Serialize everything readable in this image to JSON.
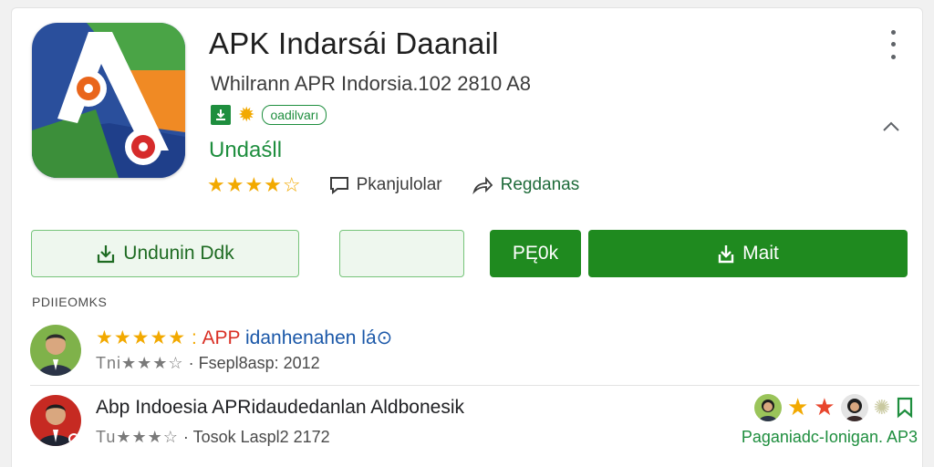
{
  "app": {
    "title": "APK Indarsái Daanail",
    "subtitle": "Whilrann APR Indorsia.102 2810 A8",
    "badge_pill": "oadilvarı",
    "status": "Undaśll",
    "rating_stars": "★★★★☆",
    "review_count_label": "Pkanjulolar",
    "share_label": "Regdanas",
    "accent_color": "#1e8e3e",
    "star_color": "#f2a900"
  },
  "actions": {
    "install_label": "Undunin Ddk",
    "empty_label": "",
    "primary_label": "PĘ0k",
    "open_label": "Mait"
  },
  "reviews": {
    "section_label": "PDIIEOMKS",
    "items": [
      {
        "stars": "★★★★★",
        "headline_red": "APP",
        "headline_blue": "idanhenahen lá⊙",
        "author_stars": "Tni★★★☆",
        "date": "Fsepl8asp: 2012"
      },
      {
        "headline": "Abp Indoesia APRidaudedanlan Aldbonesik",
        "author_stars": "Tu★★★☆",
        "date": "Tosok Laspl2 2172",
        "link": "Paganiadc-Ionigan. AP3"
      }
    ]
  }
}
